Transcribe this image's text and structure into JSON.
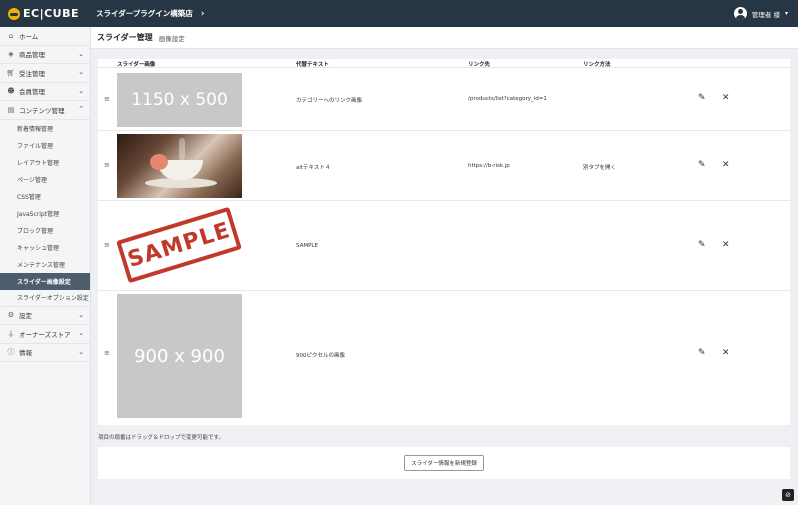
{
  "header": {
    "logo": "EC|CUBE",
    "shop_name": "スライダープラグイン構築店",
    "user_name": "管理者 様"
  },
  "sidebar": {
    "items": [
      {
        "label": "ホーム",
        "icon": "home-icon"
      },
      {
        "label": "商品管理",
        "icon": "cube-icon"
      },
      {
        "label": "受注管理",
        "icon": "cart-icon"
      },
      {
        "label": "会員管理",
        "icon": "users-icon"
      },
      {
        "label": "コンテンツ管理",
        "icon": "document-icon"
      }
    ],
    "content_sub": [
      "新着情報管理",
      "ファイル管理",
      "レイアウト管理",
      "ページ管理",
      "CSS管理",
      "JavaScript管理",
      "ブロック管理",
      "キャッシュ管理",
      "メンテナンス管理",
      "スライダー画像設定",
      "スライダーオプション設定"
    ],
    "bottom_items": [
      {
        "label": "設定",
        "icon": "gear-icon"
      },
      {
        "label": "オーナーズストア",
        "icon": "plug-icon"
      },
      {
        "label": "情報",
        "icon": "info-icon"
      }
    ]
  },
  "page": {
    "title": "スライダー管理",
    "subtitle": "画像設定"
  },
  "table": {
    "headers": [
      "スライダー画像",
      "代替テキスト",
      "リンク先",
      "リンク方法"
    ],
    "rows": [
      {
        "image_label": "1150 x 500",
        "alt": "カテゴリーへのリンク画像",
        "link": "/products/list?category_id=1",
        "method": ""
      },
      {
        "image_label": "",
        "alt": "altテキスト４",
        "link": "https://b-risk.jp",
        "method": "別タブを開く"
      },
      {
        "image_label": "SAMPLE",
        "alt": "SAMPLE",
        "link": "",
        "method": ""
      },
      {
        "image_label": "900 x 900",
        "alt": "900ピクセルの画像",
        "link": "",
        "method": ""
      }
    ]
  },
  "footer": {
    "note": "項目の順番はドラッグ＆ドロップで変更可能です。",
    "add_button": "スライダー情報を新規登録"
  }
}
